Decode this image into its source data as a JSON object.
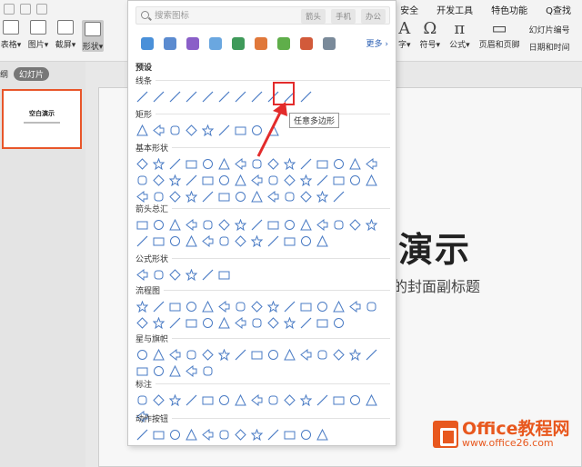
{
  "ribbon": {
    "tabs": [
      "安全",
      "开发工具",
      "特色功能",
      "Q查找"
    ],
    "tools_left": [
      {
        "icon": "table-icon",
        "label": "表格▾"
      },
      {
        "icon": "picture-icon",
        "label": "图片▾"
      },
      {
        "icon": "crop-icon",
        "label": "截屏▾"
      },
      {
        "icon": "shapes-icon",
        "label": "形状▾"
      }
    ],
    "tools_right": {
      "text_label": "字▾",
      "symbol_glyph": "Ω",
      "symbol_label": "符号▾",
      "formula_glyph": "π",
      "formula_label": "公式▾",
      "header_footer_label": "页眉和页脚",
      "slide_number_label": "幻灯片编号",
      "date_time_label": "日期和时间"
    }
  },
  "pane": {
    "tab_outline": "纲",
    "tab_slides": "幻灯片",
    "thumb_title": "空白演示"
  },
  "slide": {
    "title": "演示",
    "subtitle": "的封面副标题"
  },
  "watermark": {
    "brand": "Office教程网",
    "url": "www.office26.com"
  },
  "dropdown": {
    "search_placeholder": "搜索图标",
    "search_tags": [
      "箭头",
      "手机",
      "办公"
    ],
    "more_label": "更多 ›",
    "preset_label": "预设",
    "tooltip": "任意多边形",
    "sections": [
      {
        "title": "线条",
        "count": 11
      },
      {
        "title": "矩形",
        "count": 9
      },
      {
        "title": "基本形状",
        "count": 43
      },
      {
        "title": "箭头总汇",
        "count": 27
      },
      {
        "title": "公式形状",
        "count": 6
      },
      {
        "title": "流程图",
        "count": 28
      },
      {
        "title": "星与旗帜",
        "count": 20
      },
      {
        "title": "标注",
        "count": 16
      },
      {
        "title": "动作按钮",
        "count": 12
      }
    ]
  }
}
